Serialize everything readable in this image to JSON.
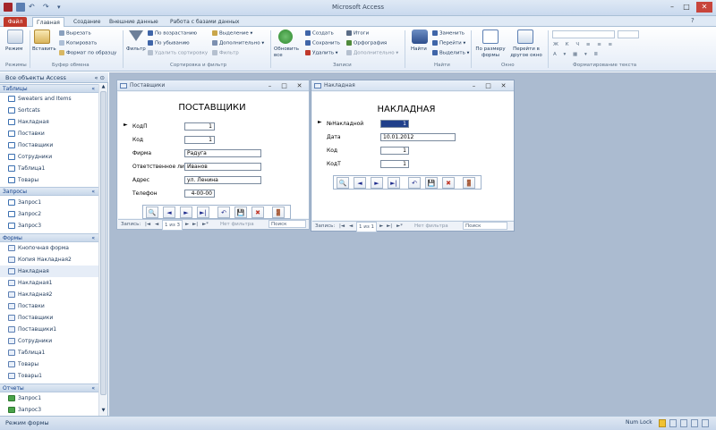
{
  "app": {
    "title": "Microsoft Access"
  },
  "tabs": {
    "file": "Файл",
    "items": [
      "Главная",
      "Создание",
      "Внешние данные",
      "Работа с базами данных"
    ]
  },
  "ribbon": {
    "view": {
      "label": "Режим",
      "group": "Режимы"
    },
    "clipboard": {
      "paste": "Вставить",
      "cut": "Вырезать",
      "copy": "Копировать",
      "format_painter": "Формат по образцу",
      "group": "Буфер обмена"
    },
    "sort": {
      "filter": "Фильтр",
      "ascending": "По возрастанию",
      "descending": "По убыванию",
      "remove_sort": "Удалить сортировку",
      "selection": "Выделение",
      "advanced": "Дополнительно",
      "toggle_filter": "Фильтр",
      "group": "Сортировка и фильтр"
    },
    "records": {
      "refresh": "Обновить все",
      "new": "Создать",
      "save": "Сохранить",
      "delete": "Удалить",
      "totals": "Итоги",
      "spelling": "Орфография",
      "more": "Дополнительно",
      "group": "Записи"
    },
    "find": {
      "find": "Найти",
      "replace": "Заменить",
      "goto": "Перейти",
      "select": "Выделить",
      "group": "Найти"
    },
    "window": {
      "fit": "По размеру формы",
      "switch": "Перейти в другое окно",
      "group": "Окно"
    },
    "text": {
      "group": "Форматирование текста"
    }
  },
  "nav": {
    "header": "Все объекты Access",
    "tables_title": "Таблицы",
    "tables": [
      "Sweaters and Items",
      "Sortcats",
      "Накладная",
      "Поставки",
      "Поставщики",
      "Сотрудники",
      "Таблица1",
      "Товары"
    ],
    "queries_title": "Запросы",
    "queries": [
      "Запрос1",
      "Запрос2",
      "Запрос3"
    ],
    "forms_title": "Формы",
    "forms": [
      "Кнопочная форма",
      "Копия Накладная2",
      "Накладная",
      "Накладная1",
      "Накладная2",
      "Поставки",
      "Поставщики",
      "Поставщики1",
      "Сотрудники",
      "Таблица1",
      "Товары",
      "Товары1"
    ],
    "forms_selected": 2,
    "reports_title": "Отчеты",
    "reports": [
      "Запрос1",
      "Запрос3"
    ]
  },
  "form_suppliers": {
    "window_title": "Поставщики",
    "header": "ПОСТАВЩИКИ",
    "fields": [
      {
        "label": "КодП",
        "value": "1"
      },
      {
        "label": "Код",
        "value": "1"
      },
      {
        "label": "Фирма",
        "value": "Радуга"
      },
      {
        "label": "Ответственное лицо",
        "value": "Иванов"
      },
      {
        "label": "Адрес",
        "value": "ул. Ленина"
      },
      {
        "label": "Телефон",
        "value": "4-00-00"
      }
    ],
    "record_nav": {
      "label": "Запись:",
      "first": "|◄",
      "prev": "◄",
      "current": "1 из 3",
      "next": "►",
      "last": "►|",
      "new": "►*",
      "filter": "Нет фильтра",
      "search": "Поиск"
    }
  },
  "form_invoice": {
    "window_title": "Накладная",
    "header": "НАКЛАДНАЯ",
    "fields": [
      {
        "label": "№Накладной",
        "value": "1"
      },
      {
        "label": "Дата",
        "value": "10.01.2012"
      },
      {
        "label": "Код",
        "value": "1"
      },
      {
        "label": "КодТ",
        "value": "1"
      }
    ],
    "record_nav": {
      "label": "Запись:",
      "first": "|◄",
      "prev": "◄",
      "current": "1 из 1",
      "next": "►",
      "last": "►|",
      "new": "►*",
      "filter": "Нет фильтра",
      "search": "Поиск"
    }
  },
  "toolbar_icons": {
    "find": "🔍",
    "prev": "◄",
    "next": "►",
    "last": "►|",
    "undo": "↶",
    "save": "💾",
    "delete": "✖",
    "exit": "🚪"
  },
  "status": {
    "left": "Режим формы",
    "numlock": "Num Lock"
  }
}
